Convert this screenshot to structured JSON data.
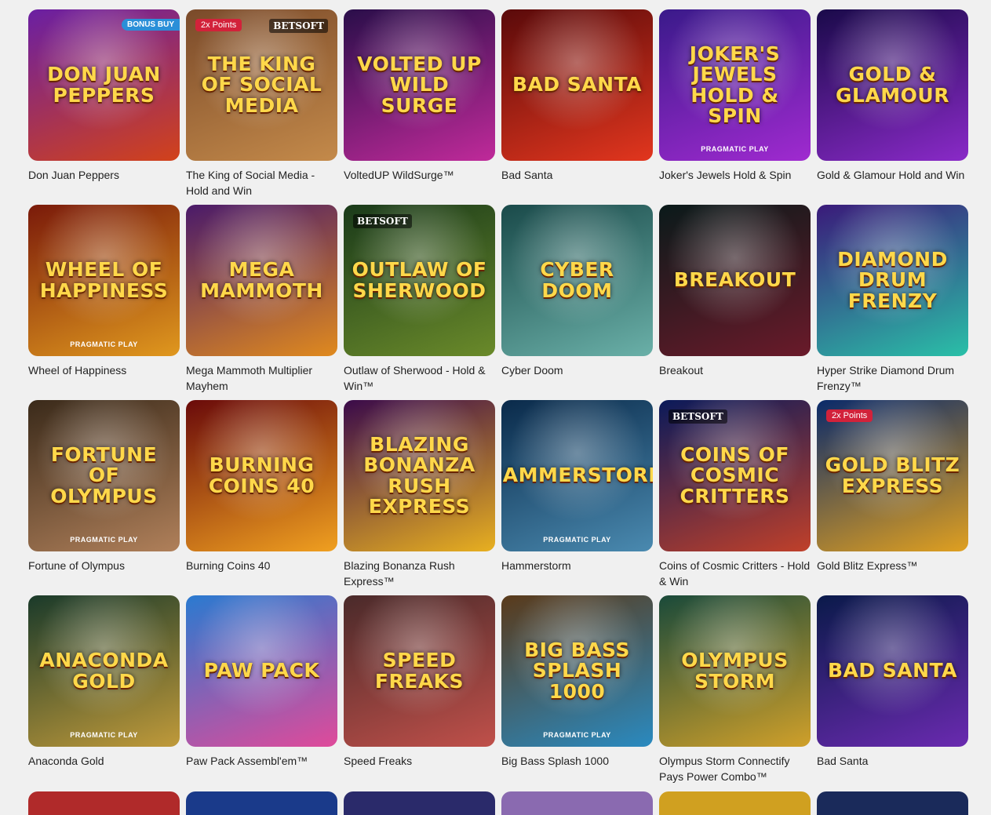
{
  "games": [
    {
      "title": "Don Juan Peppers",
      "art": "DON JUAN PEPPERS",
      "badge": "BONUS BUY",
      "bg": [
        "#6a1fa3",
        "#d2421a"
      ],
      "icon": "pepper-icon"
    },
    {
      "title": "The King of Social Media - Hold and Win",
      "art": "THE KING OF SOCIAL MEDIA",
      "points": "2x Points",
      "brand": "BETSOFT",
      "bg": [
        "#7a4a2a",
        "#c48a4a"
      ],
      "icon": "crown-icon"
    },
    {
      "title": "VoltedUP WildSurge™",
      "art": "VOLTED UP WILD SURGE",
      "bg": [
        "#2a0e4a",
        "#c02a9a"
      ],
      "icon": "lightning-icon"
    },
    {
      "title": "Bad Santa",
      "art": "BAD SANTA",
      "bg": [
        "#5a0a0a",
        "#e2361e"
      ],
      "icon": "santa-icon"
    },
    {
      "title": "Joker's Jewels Hold & Spin",
      "art": "JOKER'S JEWELS HOLD & SPIN",
      "provider": "PRAGMATIC PLAY",
      "bg": [
        "#3a1a8a",
        "#a02ad0"
      ],
      "icon": "joker-icon"
    },
    {
      "title": "Gold & Glamour Hold and Win",
      "art": "GOLD & GLAMOUR",
      "bg": [
        "#1a0a4a",
        "#8a2ac8"
      ],
      "icon": "ferris-wheel-icon"
    },
    {
      "title": "Wheel of Happiness",
      "art": "WHEEL OF HAPPINESS",
      "provider": "PRAGMATIC PLAY",
      "bg": [
        "#7a1a0a",
        "#e0981e"
      ],
      "icon": "dragon-icon"
    },
    {
      "title": "Mega Mammoth Multiplier Mayhem",
      "art": "MEGA MAMMOTH",
      "bg": [
        "#4a1a6a",
        "#e08a1e"
      ],
      "icon": "mammoth-icon"
    },
    {
      "title": "Outlaw of Sherwood - Hold & Win™",
      "art": "OUTLAW OF SHERWOOD",
      "brand": "BETSOFT",
      "bg": [
        "#1a3a1a",
        "#6a8a2a"
      ],
      "icon": "archer-icon"
    },
    {
      "title": "Cyber Doom",
      "art": "CYBER DOOM",
      "bg": [
        "#1a4a4a",
        "#6ab0a8"
      ],
      "icon": "robot-icon"
    },
    {
      "title": "Breakout",
      "art": "BREAKOUT",
      "bg": [
        "#0a1a1a",
        "#6a1a2a"
      ],
      "icon": "character-icon"
    },
    {
      "title": "Hyper Strike Diamond Drum Frenzy™",
      "art": "DIAMOND DRUM FRENZY",
      "bg": [
        "#3a1a7a",
        "#2ac0a8"
      ],
      "icon": "diamond-icon"
    },
    {
      "title": "Fortune of Olympus",
      "art": "FORTUNE OF OLYMPUS",
      "provider": "PRAGMATIC PLAY",
      "bg": [
        "#3a2a1a",
        "#b0805a"
      ],
      "icon": "zeus-icon"
    },
    {
      "title": "Burning Coins 40",
      "art": "BURNING COINS 40",
      "bg": [
        "#6a0a0a",
        "#f0a020"
      ],
      "icon": "fire-icon"
    },
    {
      "title": "Blazing Bonanza Rush Express™",
      "art": "BLAZING BONANZA RUSH EXPRESS",
      "bg": [
        "#3a0a4a",
        "#e8b020"
      ],
      "icon": "train-icon"
    },
    {
      "title": "Hammerstorm",
      "art": "HAMMERSTORM",
      "provider": "PRAGMATIC PLAY",
      "bg": [
        "#0a2a4a",
        "#4a8ab0"
      ],
      "icon": "hammer-icon"
    },
    {
      "title": "Coins of Cosmic Critters - Hold & Win",
      "art": "COINS OF COSMIC CRITTERS",
      "brand": "BETSOFT",
      "bg": [
        "#0a1a5a",
        "#c0402a"
      ],
      "icon": "coin-icon"
    },
    {
      "title": "Gold Blitz Express™",
      "art": "GOLD BLITZ EXPRESS",
      "points": "2x Points",
      "bg": [
        "#0a2a6a",
        "#e0a020"
      ],
      "icon": "bell-icon"
    },
    {
      "title": "Anaconda Gold",
      "art": "ANACONDA GOLD",
      "provider": "PRAGMATIC PLAY",
      "bg": [
        "#1a3a2a",
        "#c09a3a"
      ],
      "icon": "snake-icon"
    },
    {
      "title": "Paw Pack Assembl'em™",
      "art": "PAW PACK",
      "bg": [
        "#2a7ad0",
        "#e04a9a"
      ],
      "icon": "dog-icon"
    },
    {
      "title": "Speed Freaks",
      "art": "SPEED FREAKS",
      "bg": [
        "#4a2a2a",
        "#c0504a"
      ],
      "icon": "car-icon"
    },
    {
      "title": "Big Bass Splash 1000",
      "art": "BIG BASS SPLASH 1000",
      "provider": "PRAGMATIC PLAY",
      "bg": [
        "#5a3a1a",
        "#2a8ac0"
      ],
      "icon": "fish-icon"
    },
    {
      "title": "Olympus Storm Connectify Pays Power Combo™",
      "art": "OLYMPUS STORM",
      "bg": [
        "#1a4a3a",
        "#d0a02a"
      ],
      "icon": "storm-icon"
    },
    {
      "title": "Bad Santa",
      "art": "BAD SANTA",
      "bg": [
        "#0a1a4a",
        "#6a2ab0"
      ],
      "icon": "santa-icon"
    }
  ],
  "partial_row_colors": [
    "#b02a2a",
    "#1a3a8a",
    "#2a2a6a",
    "#8a6ab0",
    "#d0a020",
    "#1a2a5a"
  ]
}
